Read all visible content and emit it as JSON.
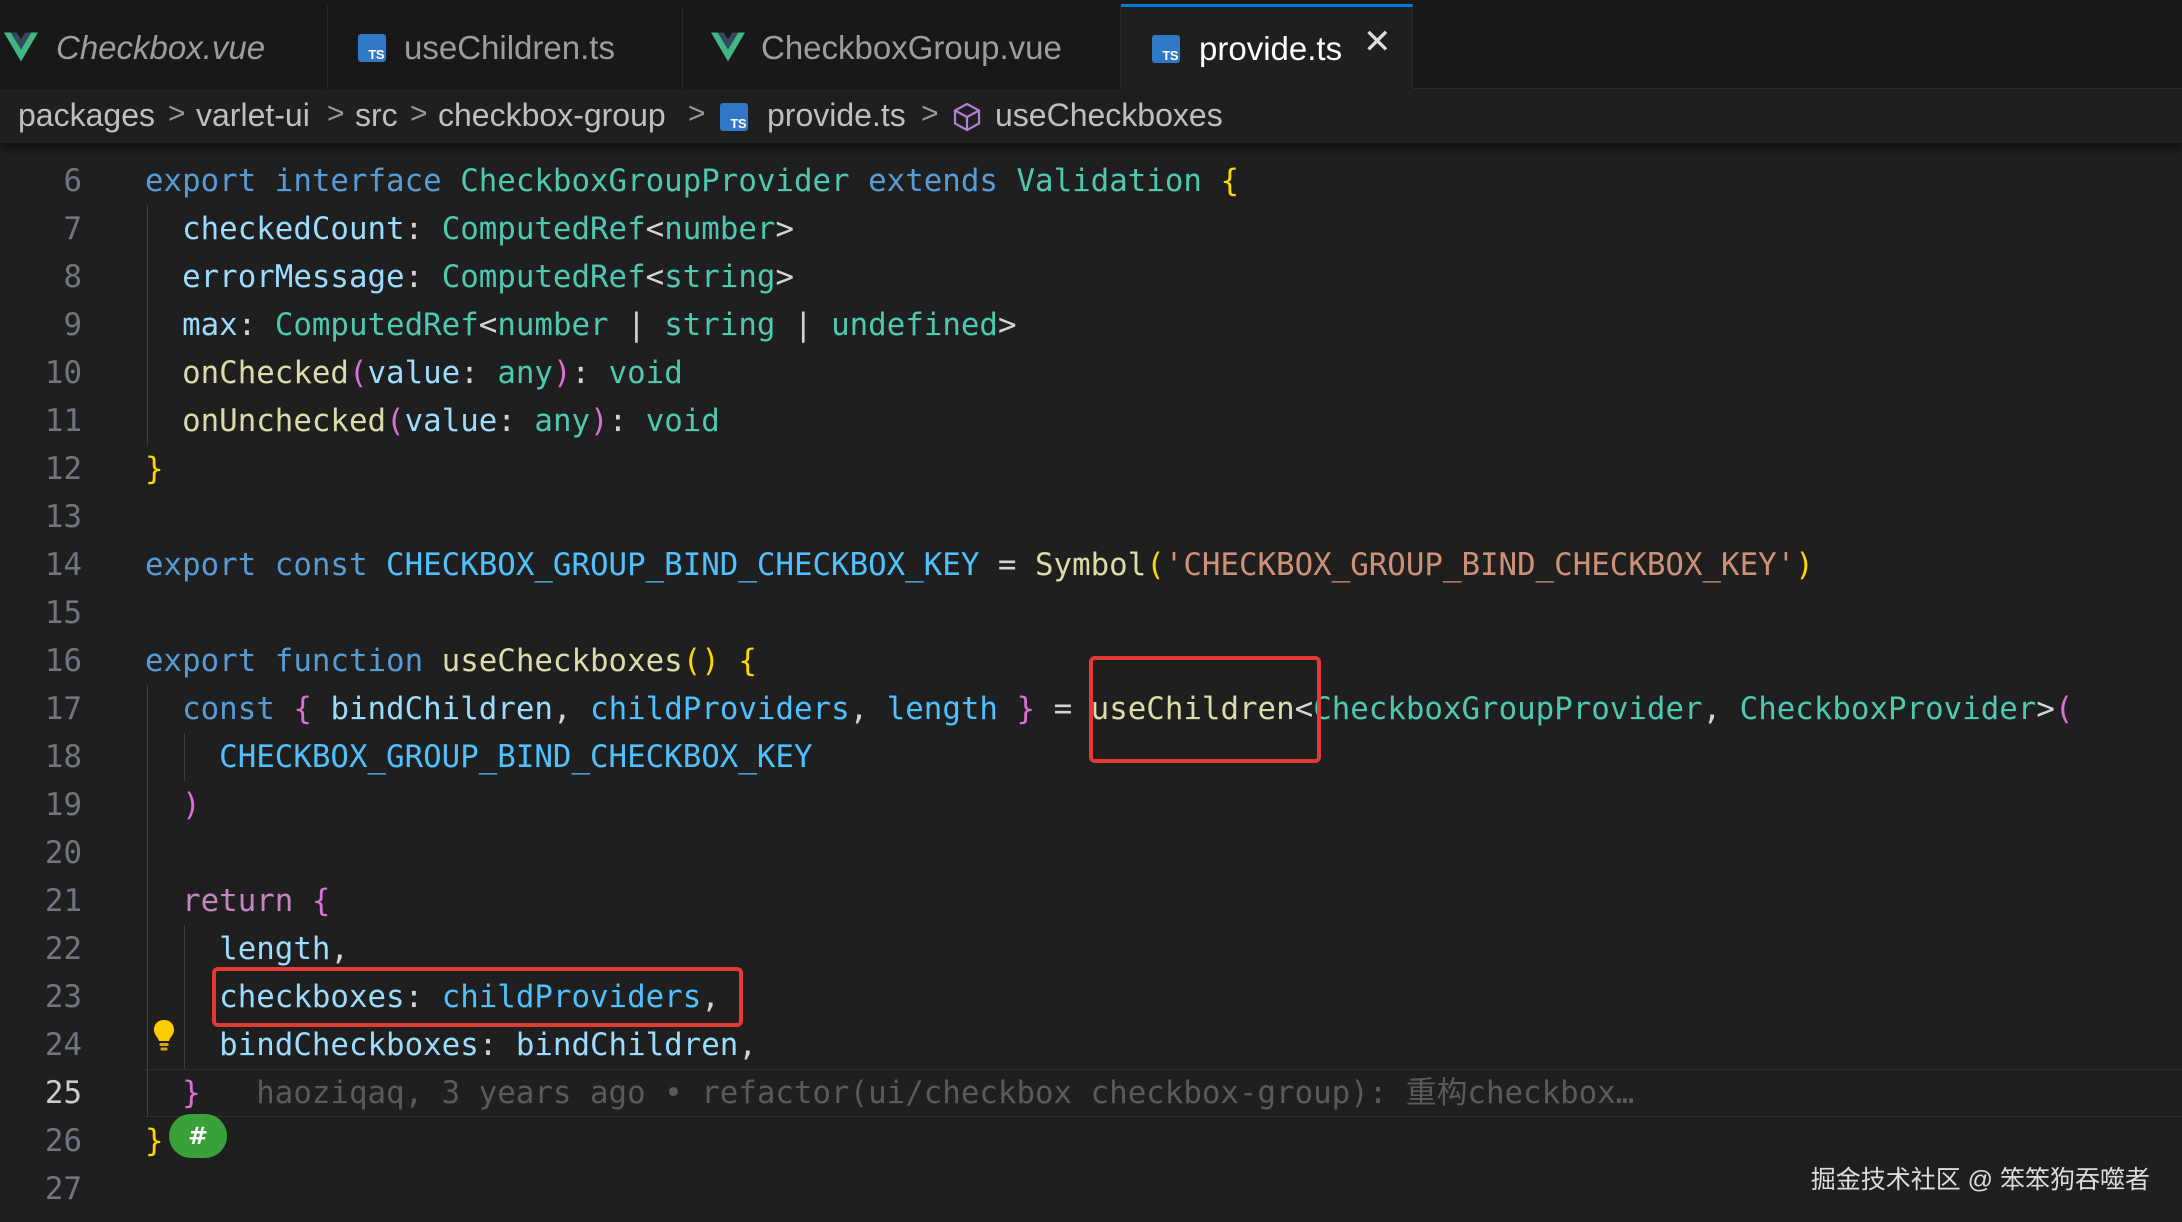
{
  "tabs": [
    {
      "label": "Checkbox.vue",
      "icon": "vue-icon"
    },
    {
      "label": "useChildren.ts",
      "icon": "ts-icon"
    },
    {
      "label": "CheckboxGroup.vue",
      "icon": "vue-icon"
    },
    {
      "label": "provide.ts",
      "icon": "ts-icon",
      "active": true
    }
  ],
  "tab_close_glyph": "✕",
  "ts_icon_text": "TS",
  "breadcrumb": [
    "packages",
    "varlet-ui",
    "src",
    "checkbox-group",
    "provide.ts",
    "useCheckboxes"
  ],
  "breadcrumb_separator": ">",
  "line_numbers": [
    "6",
    "7",
    "8",
    "9",
    "10",
    "11",
    "12",
    "13",
    "14",
    "15",
    "16",
    "17",
    "18",
    "19",
    "20",
    "21",
    "22",
    "23",
    "24",
    "25",
    "26",
    "27"
  ],
  "current_line": "25",
  "code_lines": [
    [
      [
        "kw",
        "export "
      ],
      [
        "kw",
        "interface "
      ],
      [
        "ty",
        "CheckboxGroupProvider "
      ],
      [
        "kw",
        "extends "
      ],
      [
        "ty",
        "Validation "
      ],
      [
        "b1",
        "{"
      ]
    ],
    [
      [
        "pn",
        "  "
      ],
      [
        "pr",
        "checkedCount"
      ],
      [
        "pn",
        ": "
      ],
      [
        "ty",
        "ComputedRef"
      ],
      [
        "pn",
        "<"
      ],
      [
        "ty",
        "number"
      ],
      [
        "pn",
        ">"
      ]
    ],
    [
      [
        "pn",
        "  "
      ],
      [
        "pr",
        "errorMessage"
      ],
      [
        "pn",
        ": "
      ],
      [
        "ty",
        "ComputedRef"
      ],
      [
        "pn",
        "<"
      ],
      [
        "ty",
        "string"
      ],
      [
        "pn",
        ">"
      ]
    ],
    [
      [
        "pn",
        "  "
      ],
      [
        "pr",
        "max"
      ],
      [
        "pn",
        ": "
      ],
      [
        "ty",
        "ComputedRef"
      ],
      [
        "pn",
        "<"
      ],
      [
        "ty",
        "number"
      ],
      [
        "pn",
        " | "
      ],
      [
        "ty",
        "string"
      ],
      [
        "pn",
        " | "
      ],
      [
        "ty",
        "undefined"
      ],
      [
        "pn",
        ">"
      ]
    ],
    [
      [
        "pn",
        "  "
      ],
      [
        "fn",
        "onChecked"
      ],
      [
        "b2",
        "("
      ],
      [
        "pr",
        "value"
      ],
      [
        "pn",
        ": "
      ],
      [
        "ty",
        "any"
      ],
      [
        "b2",
        ")"
      ],
      [
        "pn",
        ": "
      ],
      [
        "ty",
        "void"
      ]
    ],
    [
      [
        "pn",
        "  "
      ],
      [
        "fn",
        "onUnchecked"
      ],
      [
        "b2",
        "("
      ],
      [
        "pr",
        "value"
      ],
      [
        "pn",
        ": "
      ],
      [
        "ty",
        "any"
      ],
      [
        "b2",
        ")"
      ],
      [
        "pn",
        ": "
      ],
      [
        "ty",
        "void"
      ]
    ],
    [
      [
        "b1",
        "}"
      ]
    ],
    [],
    [
      [
        "kw",
        "export "
      ],
      [
        "kw",
        "const "
      ],
      [
        "cn",
        "CHECKBOX_GROUP_BIND_CHECKBOX_KEY"
      ],
      [
        "pn",
        " = "
      ],
      [
        "fn",
        "Symbol"
      ],
      [
        "b1",
        "("
      ],
      [
        "st",
        "'CHECKBOX_GROUP_BIND_CHECKBOX_KEY'"
      ],
      [
        "b1",
        ")"
      ]
    ],
    [],
    [
      [
        "kw",
        "export "
      ],
      [
        "kw",
        "function "
      ],
      [
        "fn",
        "useCheckboxes"
      ],
      [
        "b1",
        "() {"
      ]
    ],
    [
      [
        "pn",
        "  "
      ],
      [
        "kw",
        "const "
      ],
      [
        "b2",
        "{ "
      ],
      [
        "pr",
        "bindChildren"
      ],
      [
        "pn",
        ", "
      ],
      [
        "cn",
        "childProviders"
      ],
      [
        "pn",
        ", "
      ],
      [
        "cn",
        "length"
      ],
      [
        "b2",
        " }"
      ],
      [
        "pn",
        " = "
      ],
      [
        "fn",
        "useChildren"
      ],
      [
        "pn",
        "<"
      ],
      [
        "ty",
        "CheckboxGroupProvider"
      ],
      [
        "pn",
        ", "
      ],
      [
        "ty",
        "CheckboxProvider"
      ],
      [
        "pn",
        ">"
      ],
      [
        "b2",
        "("
      ]
    ],
    [
      [
        "pn",
        "    "
      ],
      [
        "cn",
        "CHECKBOX_GROUP_BIND_CHECKBOX_KEY"
      ]
    ],
    [
      [
        "pn",
        "  "
      ],
      [
        "b2",
        ")"
      ]
    ],
    [],
    [
      [
        "pn",
        "  "
      ],
      [
        "ctl",
        "return "
      ],
      [
        "b2",
        "{"
      ]
    ],
    [
      [
        "pn",
        "    "
      ],
      [
        "pr",
        "length"
      ],
      [
        "pn",
        ","
      ]
    ],
    [
      [
        "pn",
        "    "
      ],
      [
        "pr",
        "checkboxes"
      ],
      [
        "pn",
        ": "
      ],
      [
        "cn",
        "childProviders"
      ],
      [
        "pn",
        ","
      ]
    ],
    [
      [
        "pn",
        "    "
      ],
      [
        "pr",
        "bindCheckboxes"
      ],
      [
        "pn",
        ": "
      ],
      [
        "pr",
        "bindChildren"
      ],
      [
        "pn",
        ","
      ]
    ],
    [
      [
        "pn",
        "  "
      ],
      [
        "b2",
        "}"
      ],
      [
        "pn",
        "   "
      ],
      [
        "blame",
        "haoziqaq, 3 years ago • refactor(ui/checkbox checkbox-group): 重构checkbox…"
      ]
    ],
    [
      [
        "b1",
        "}"
      ]
    ],
    []
  ],
  "badge_text": "#",
  "watermark": "掘金技术社区 @ 笨笨狗吞噬者",
  "colors": {
    "editor_bg": "#1f1f1f",
    "tab_active_accent": "#0078d4",
    "highlight_box": "#e53935",
    "badge_green": "#3aa03a"
  }
}
